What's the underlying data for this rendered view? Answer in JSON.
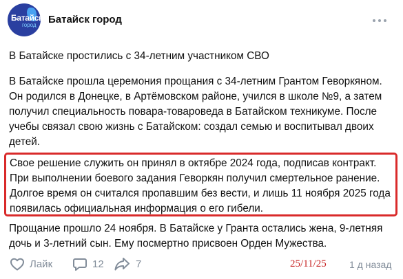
{
  "community": {
    "name": "Батайск город",
    "avatar_text": "Батайск",
    "avatar_subtext": "город"
  },
  "post": {
    "title": "В Батайске простились с 34-летним участником СВО",
    "paragraph_1": "В Батайске прошла церемония прощания с 34-летним Грантом Геворкяном. Он родился в Донецке, в Артёмовском районе, учился в школе №9, а затем получил специальность повара-товароведа в Батайском техникуме. После учебы связал свою жизнь с Батайском: создал семью и воспитывал двоих детей.",
    "paragraph_2": "Свое решение служить он принял в октябре 2024 года, подписав контракт. При выполнении боевого задания Геворкян получил смертельное ранение. Долгое время он считался пропавшим без вести, и лишь 11 ноября 2025 года появилась официальная информация о его гибели.",
    "paragraph_3": "Прощание прошло 24 ноября. В Батайске у Гранта остались жена, 9-летняя дочь и 3-летний сын. Ему посмертно присвоен Орден Мужества."
  },
  "actions": {
    "like_label": "Лайк",
    "comments_count": "12",
    "shares_count": "7",
    "time_ago": "1 д назад"
  },
  "overlay_date": "25/11/25",
  "colors": {
    "highlight_border": "#d92a2a",
    "overlay_date": "#c62020",
    "icon_gray": "#818c99",
    "avatar_bg": "#2a3fa0"
  },
  "icons": [
    "more-dots-icon",
    "like-heart-icon",
    "comment-icon",
    "share-arrow-icon"
  ]
}
